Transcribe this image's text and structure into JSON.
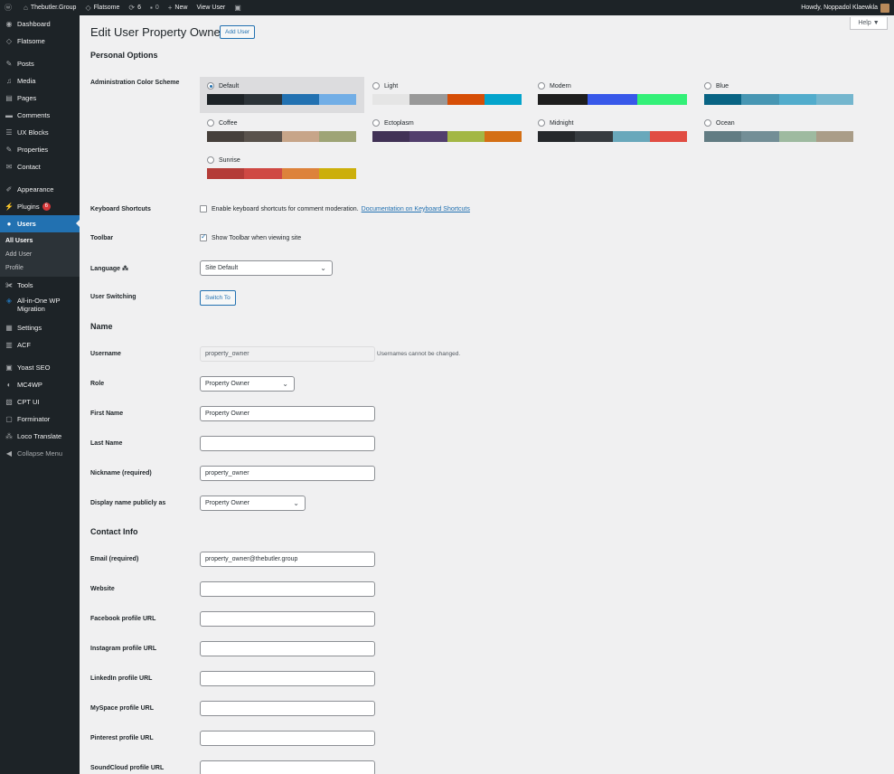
{
  "adminbar": {
    "site_name": "Thebutler.Group",
    "theme_name": "Flatsome",
    "updates_count": "6",
    "comments_count": "0",
    "new_label": "New",
    "view_user_label": "View User",
    "greeting": "Howdy, Noppadol Klaewkla"
  },
  "sidebar": {
    "dashboard": "Dashboard",
    "flatsome": "Flatsome",
    "posts": "Posts",
    "media": "Media",
    "pages": "Pages",
    "comments": "Comments",
    "ux_blocks": "UX Blocks",
    "properties": "Properties",
    "contact": "Contact",
    "appearance": "Appearance",
    "plugins": "Plugins",
    "plugins_badge": "6",
    "users": "Users",
    "sub_all_users": "All Users",
    "sub_add_user": "Add User",
    "sub_profile": "Profile",
    "tools": "Tools",
    "migration_line1": "All-in-One WP",
    "migration_line2": "Migration",
    "settings": "Settings",
    "acf": "ACF",
    "yoast": "Yoast SEO",
    "mc4wp": "MC4WP",
    "cpt_ui": "CPT UI",
    "forminator": "Forminator",
    "loco": "Loco Translate",
    "collapse": "Collapse Menu"
  },
  "header": {
    "title": "Edit User Property Owner",
    "add_user_button": "Add User",
    "help_tab": "Help ▼"
  },
  "personal_options": {
    "section_title": "Personal Options",
    "color_scheme_label": "Administration Color Scheme",
    "schemes": [
      {
        "name": "Default",
        "selected": true,
        "colors": [
          "#1d2327",
          "#2c3338",
          "#2271b1",
          "#72aee6"
        ]
      },
      {
        "name": "Light",
        "selected": false,
        "colors": [
          "#e5e5e5",
          "#999999",
          "#d64e07",
          "#04a4cc"
        ]
      },
      {
        "name": "Modern",
        "selected": false,
        "colors": [
          "#1e1e1e",
          "#3858e9",
          "#33f078"
        ]
      },
      {
        "name": "Blue",
        "selected": false,
        "colors": [
          "#096484",
          "#4796b3",
          "#52accc",
          "#74b6ce"
        ]
      },
      {
        "name": "Coffee",
        "selected": false,
        "colors": [
          "#46403c",
          "#59524c",
          "#c7a589",
          "#9ea476"
        ]
      },
      {
        "name": "Ectoplasm",
        "selected": false,
        "colors": [
          "#413256",
          "#523f6d",
          "#a3b745",
          "#d46f15"
        ]
      },
      {
        "name": "Midnight",
        "selected": false,
        "colors": [
          "#25282b",
          "#363b3f",
          "#69a8bb",
          "#e14d43"
        ]
      },
      {
        "name": "Ocean",
        "selected": false,
        "colors": [
          "#627c83",
          "#738e96",
          "#9ebaa0",
          "#aa9d88"
        ]
      },
      {
        "name": "Sunrise",
        "selected": false,
        "colors": [
          "#b43c38",
          "#cf4944",
          "#dd823b",
          "#ccaf0b"
        ]
      }
    ],
    "keyboard_label": "Keyboard Shortcuts",
    "keyboard_text": "Enable keyboard shortcuts for comment moderation.",
    "keyboard_link": "Documentation on Keyboard Shortcuts",
    "toolbar_label": "Toolbar",
    "toolbar_text": "Show Toolbar when viewing site",
    "language_label": "Language",
    "language_value": "Site Default",
    "switching_label": "User Switching",
    "switch_to_button": "Switch To"
  },
  "name_section": {
    "section_title": "Name",
    "username_label": "Username",
    "username_value": "property_owner",
    "username_note": "Usernames cannot be changed.",
    "role_label": "Role",
    "role_value": "Property Owner",
    "first_name_label": "First Name",
    "first_name_value": "Property Owner",
    "last_name_label": "Last Name",
    "last_name_value": "",
    "nickname_label": "Nickname (required)",
    "nickname_value": "property_owner",
    "display_name_label": "Display name publicly as",
    "display_name_value": "Property Owner"
  },
  "contact_section": {
    "section_title": "Contact Info",
    "email_label": "Email (required)",
    "email_value": "property_owner@thebutler.group",
    "website_label": "Website",
    "facebook_label": "Facebook profile URL",
    "instagram_label": "Instagram profile URL",
    "linkedin_label": "LinkedIn profile URL",
    "myspace_label": "MySpace profile URL",
    "pinterest_label": "Pinterest profile URL",
    "soundcloud_label": "SoundCloud profile URL"
  }
}
